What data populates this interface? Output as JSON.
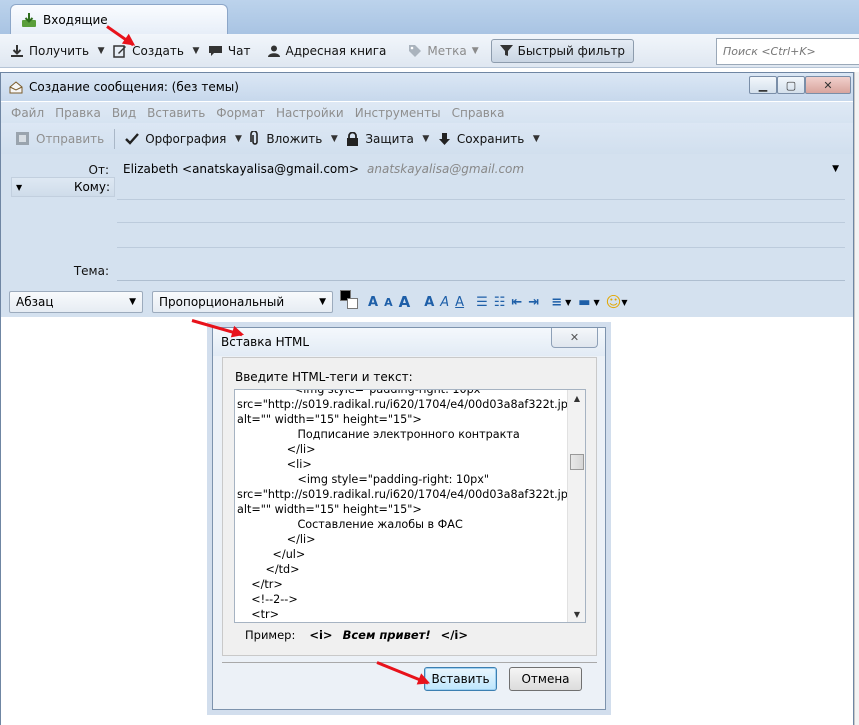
{
  "main_window": {
    "tab_label": "Входящие",
    "toolbar": {
      "get_mail": "Получить",
      "write": "Создать",
      "chat": "Чат",
      "address_book": "Адресная книга",
      "tag": "Метка",
      "quick_filter": "Быстрый фильтр"
    },
    "search_placeholder": "Поиск <Ctrl+K>"
  },
  "compose_window": {
    "title": "Создание сообщения: (без темы)",
    "menus": [
      "Файл",
      "Правка",
      "Вид",
      "Вставить",
      "Формат",
      "Настройки",
      "Инструменты",
      "Справка"
    ],
    "toolbar": {
      "send": "Отправить",
      "spelling": "Орфография",
      "attach": "Вложить",
      "security": "Защита",
      "save": "Сохранить"
    },
    "from_label": "От:",
    "from_value": "Elizabeth <anatskayalisa@gmail.com>",
    "from_identity": "anatskayalisa@gmail.com",
    "to_label": "Кому:",
    "subject_label": "Тема:",
    "paragraph_format": "Абзац",
    "font": "Пропорциональный"
  },
  "insert_html_dialog": {
    "title": "Вставка HTML",
    "prompt": "Введите HTML-теги и текст:",
    "content": "                <img style=\"padding-right: 10px\"\nsrc=\"http://s019.radikal.ru/i620/1704/e4/00d03a8af322t.jpg\"\nalt=\"\" width=\"15\" height=\"15\">\n                 Подписание электронного контракта\n              </li>\n              <li>\n                 <img style=\"padding-right: 10px\"\nsrc=\"http://s019.radikal.ru/i620/1704/e4/00d03a8af322t.jpg\"\nalt=\"\" width=\"15\" height=\"15\">\n                 Составление жалобы в ФАС\n              </li>\n          </ul>\n        </td>\n    </tr>\n    <!--2-->\n    <tr>",
    "example_label": "Пример:",
    "example_open": "<i>",
    "example_text": "Всем привет!",
    "example_close": "</i>",
    "ok_button": "Вставить",
    "cancel_button": "Отмена"
  },
  "colors": {
    "annotation_arrow": "#e8121b",
    "toolbar_bg": "#d4e1ef"
  }
}
